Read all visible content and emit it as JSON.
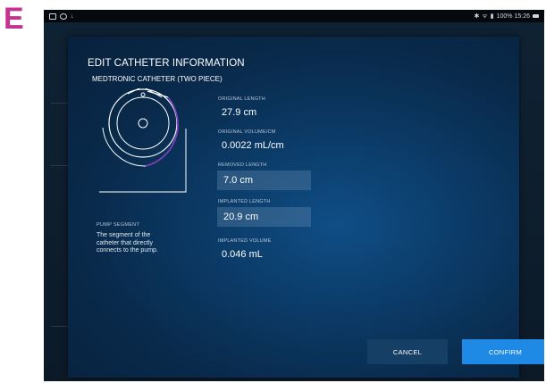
{
  "panel_label": "E",
  "statusbar": {
    "right_text": "100% 15:26"
  },
  "dialog": {
    "title": "EDIT CATHETER INFORMATION",
    "subtitle": "MEDTRONIC CATHETER (TWO PIECE)",
    "segment": {
      "title": "PUMP SEGMENT",
      "description": "The segment of the catheter that directly connects to the pump."
    },
    "fields": {
      "original_length": {
        "label": "ORIGINAL LENGTH",
        "value": "27.9 cm"
      },
      "original_volume": {
        "label": "ORIGINAL VOLUME/CM",
        "value": "0.0022 mL/cm"
      },
      "removed_length": {
        "label": "REMOVED LENGTH",
        "value": "7.0 cm"
      },
      "implanted_length": {
        "label": "IMPLANTED LENGTH",
        "value": "20.9 cm"
      },
      "implanted_volume": {
        "label": "IMPLANTED VOLUME",
        "value": "0.046 mL"
      }
    },
    "buttons": {
      "cancel": "CANCEL",
      "confirm": "CONFIRM"
    },
    "colors": {
      "accent_purple": "#7a3fb8",
      "confirm_blue": "#1f8ae6",
      "panel_letter": "#c2348f"
    }
  }
}
